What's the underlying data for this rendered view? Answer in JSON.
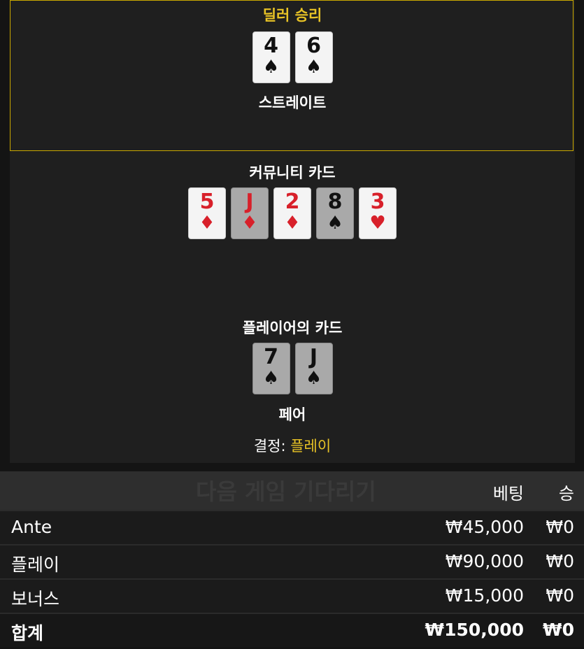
{
  "dealer": {
    "status": "딜러 승리",
    "cards": [
      {
        "rank": "4",
        "suit": "♠",
        "color": "black",
        "dim": false
      },
      {
        "rank": "6",
        "suit": "♠",
        "color": "black",
        "dim": false
      }
    ],
    "hand": "스트레이트"
  },
  "community": {
    "title": "커뮤니티 카드",
    "cards": [
      {
        "rank": "5",
        "suit": "♦",
        "color": "red",
        "dim": false
      },
      {
        "rank": "J",
        "suit": "♦",
        "color": "red",
        "dim": true
      },
      {
        "rank": "2",
        "suit": "♦",
        "color": "red",
        "dim": false
      },
      {
        "rank": "8",
        "suit": "♠",
        "color": "black",
        "dim": true
      },
      {
        "rank": "3",
        "suit": "♥",
        "color": "red",
        "dim": false
      }
    ]
  },
  "player": {
    "title": "플레이어의 카드",
    "cards": [
      {
        "rank": "7",
        "suit": "♠",
        "color": "black",
        "dim": true
      },
      {
        "rank": "J",
        "suit": "♠",
        "color": "black",
        "dim": true
      }
    ],
    "hand": "페어"
  },
  "decision": {
    "label": "결정:",
    "value": "플레이"
  },
  "bets": {
    "waiting_text": "다음 게임 기다리기",
    "col_bet": "베팅",
    "col_win": "승",
    "rows": [
      {
        "name": "Ante",
        "bet": "₩45,000",
        "win": "₩0"
      },
      {
        "name": "플레이",
        "bet": "₩90,000",
        "win": "₩0"
      },
      {
        "name": "보너스",
        "bet": "₩15,000",
        "win": "₩0"
      }
    ],
    "total": {
      "name": "합계",
      "bet": "₩150,000",
      "win": "₩0"
    }
  },
  "colors": {
    "accent": "#e8c326",
    "red_suit": "#d8202a"
  }
}
